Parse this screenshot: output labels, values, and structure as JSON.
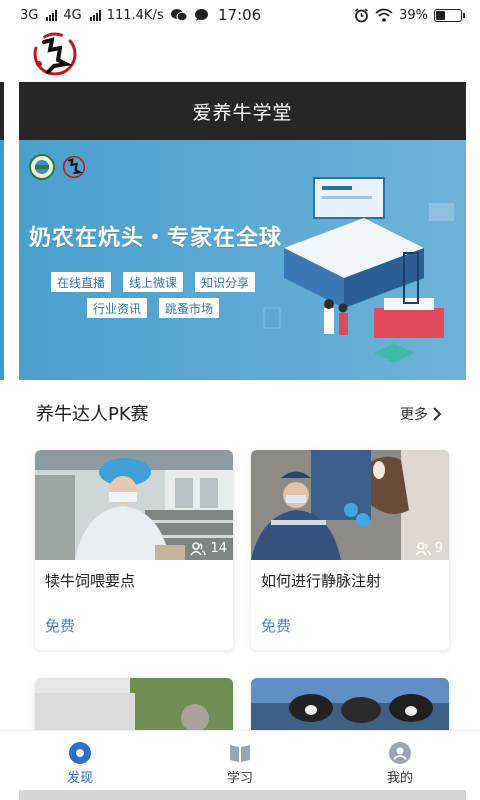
{
  "status_bar": {
    "signal1": "3G",
    "signal2": "4G",
    "speed": "111.4K/s",
    "time": "17:06",
    "battery": "39%",
    "battery_level": 0.39
  },
  "header": {
    "title": "爱养牛学堂"
  },
  "banner": {
    "slogan": "奶农在炕头・专家在全球",
    "tags": [
      "在线直播",
      "线上微课",
      "知识分享",
      "行业资讯",
      "跳蚤市场"
    ]
  },
  "section": {
    "title": "养牛达人PK赛",
    "more_label": "更多"
  },
  "cards": [
    {
      "title": "犊牛饲喂要点",
      "count": "14",
      "price": "免费"
    },
    {
      "title": "如何进行静脉注射",
      "count": "9",
      "price": "免费"
    }
  ],
  "nav": {
    "tabs": [
      {
        "label": "发现",
        "active": true
      },
      {
        "label": "学习",
        "active": false
      },
      {
        "label": "我的",
        "active": false
      }
    ]
  },
  "colors": {
    "accent": "#2f6fc6",
    "titlebar": "#262626",
    "banner": "#4c9fcd"
  }
}
